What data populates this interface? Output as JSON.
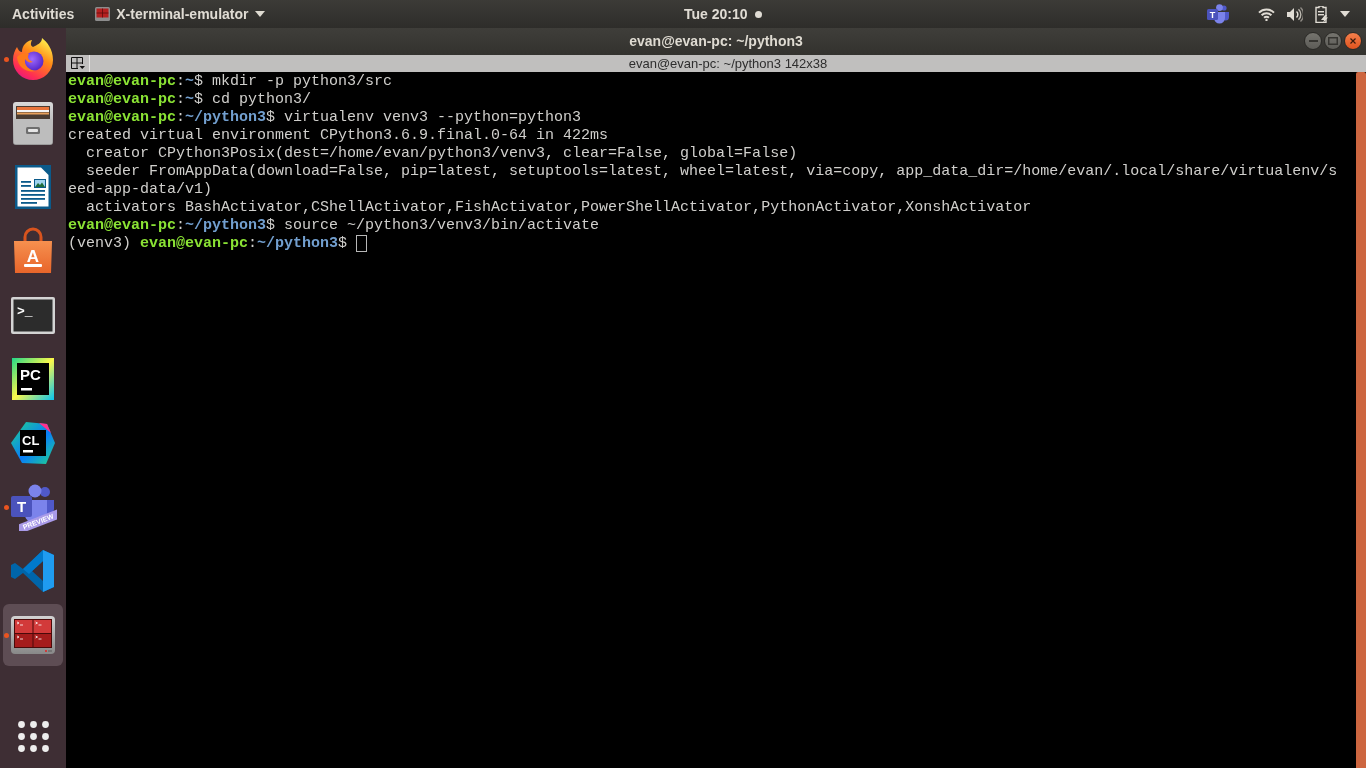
{
  "top_bar": {
    "activities": "Activities",
    "app_menu": "X-terminal-emulator",
    "clock": "Tue 20:10",
    "notification": true,
    "tray_app": {
      "label": "T"
    }
  },
  "dock": {
    "items": [
      {
        "kind": "browser",
        "running": true,
        "selected": false
      },
      {
        "kind": "cabinet",
        "running": false,
        "selected": false
      },
      {
        "kind": "writer",
        "running": false,
        "selected": false
      },
      {
        "kind": "store",
        "label": "A",
        "running": false,
        "selected": false
      },
      {
        "kind": "terminal",
        "label": ">_",
        "running": false,
        "selected": false
      },
      {
        "kind": "pcide",
        "label": "PC",
        "running": false,
        "selected": false
      },
      {
        "kind": "clide",
        "label": "CL",
        "running": false,
        "selected": false
      },
      {
        "kind": "chat",
        "label": "T",
        "ribbon": "PREVIEW",
        "running": true,
        "selected": false
      },
      {
        "kind": "editor",
        "running": false,
        "selected": false
      },
      {
        "kind": "multiterm",
        "running": true,
        "selected": true
      }
    ]
  },
  "window": {
    "title": "evan@evan-pc: ~/python3"
  },
  "terminal": {
    "title": "evan@evan-pc: ~/python3 142x38",
    "lines": [
      {
        "cursor": false,
        "segments": [
          {
            "kind": "user",
            "text": "evan@evan-pc"
          },
          {
            "kind": "plain",
            "text": ":"
          },
          {
            "kind": "path",
            "text": "~"
          },
          {
            "kind": "plain",
            "text": "$ mkdir -p python3/src"
          }
        ]
      },
      {
        "cursor": false,
        "segments": [
          {
            "kind": "user",
            "text": "evan@evan-pc"
          },
          {
            "kind": "plain",
            "text": ":"
          },
          {
            "kind": "path",
            "text": "~"
          },
          {
            "kind": "plain",
            "text": "$ cd python3/"
          }
        ]
      },
      {
        "cursor": false,
        "segments": [
          {
            "kind": "user",
            "text": "evan@evan-pc"
          },
          {
            "kind": "plain",
            "text": ":"
          },
          {
            "kind": "path",
            "text": "~/python3"
          },
          {
            "kind": "plain",
            "text": "$ virtualenv venv3 --python=python3"
          }
        ]
      },
      {
        "cursor": false,
        "segments": [
          {
            "kind": "plain",
            "text": "created virtual environment CPython3.6.9.final.0-64 in 422ms"
          }
        ]
      },
      {
        "cursor": false,
        "segments": [
          {
            "kind": "plain",
            "text": "  creator CPython3Posix(dest=/home/evan/python3/venv3, clear=False, global=False)"
          }
        ]
      },
      {
        "cursor": false,
        "segments": [
          {
            "kind": "plain",
            "text": "  seeder FromAppData(download=False, pip=latest, setuptools=latest, wheel=latest, via=copy, app_data_dir=/home/evan/.local/share/virtualenv/seed-app-data/v1)"
          }
        ]
      },
      {
        "cursor": false,
        "segments": [
          {
            "kind": "plain",
            "text": "  activators BashActivator,CShellActivator,FishActivator,PowerShellActivator,PythonActivator,XonshActivator"
          }
        ]
      },
      {
        "cursor": false,
        "segments": [
          {
            "kind": "user",
            "text": "evan@evan-pc"
          },
          {
            "kind": "plain",
            "text": ":"
          },
          {
            "kind": "path",
            "text": "~/python3"
          },
          {
            "kind": "plain",
            "text": "$ source ~/python3/venv3/bin/activate"
          }
        ]
      },
      {
        "cursor": true,
        "segments": [
          {
            "kind": "plain",
            "text": "(venv3) "
          },
          {
            "kind": "user",
            "text": "evan@evan-pc"
          },
          {
            "kind": "plain",
            "text": ":"
          },
          {
            "kind": "path",
            "text": "~/python3"
          },
          {
            "kind": "plain",
            "text": "$"
          }
        ]
      }
    ]
  }
}
